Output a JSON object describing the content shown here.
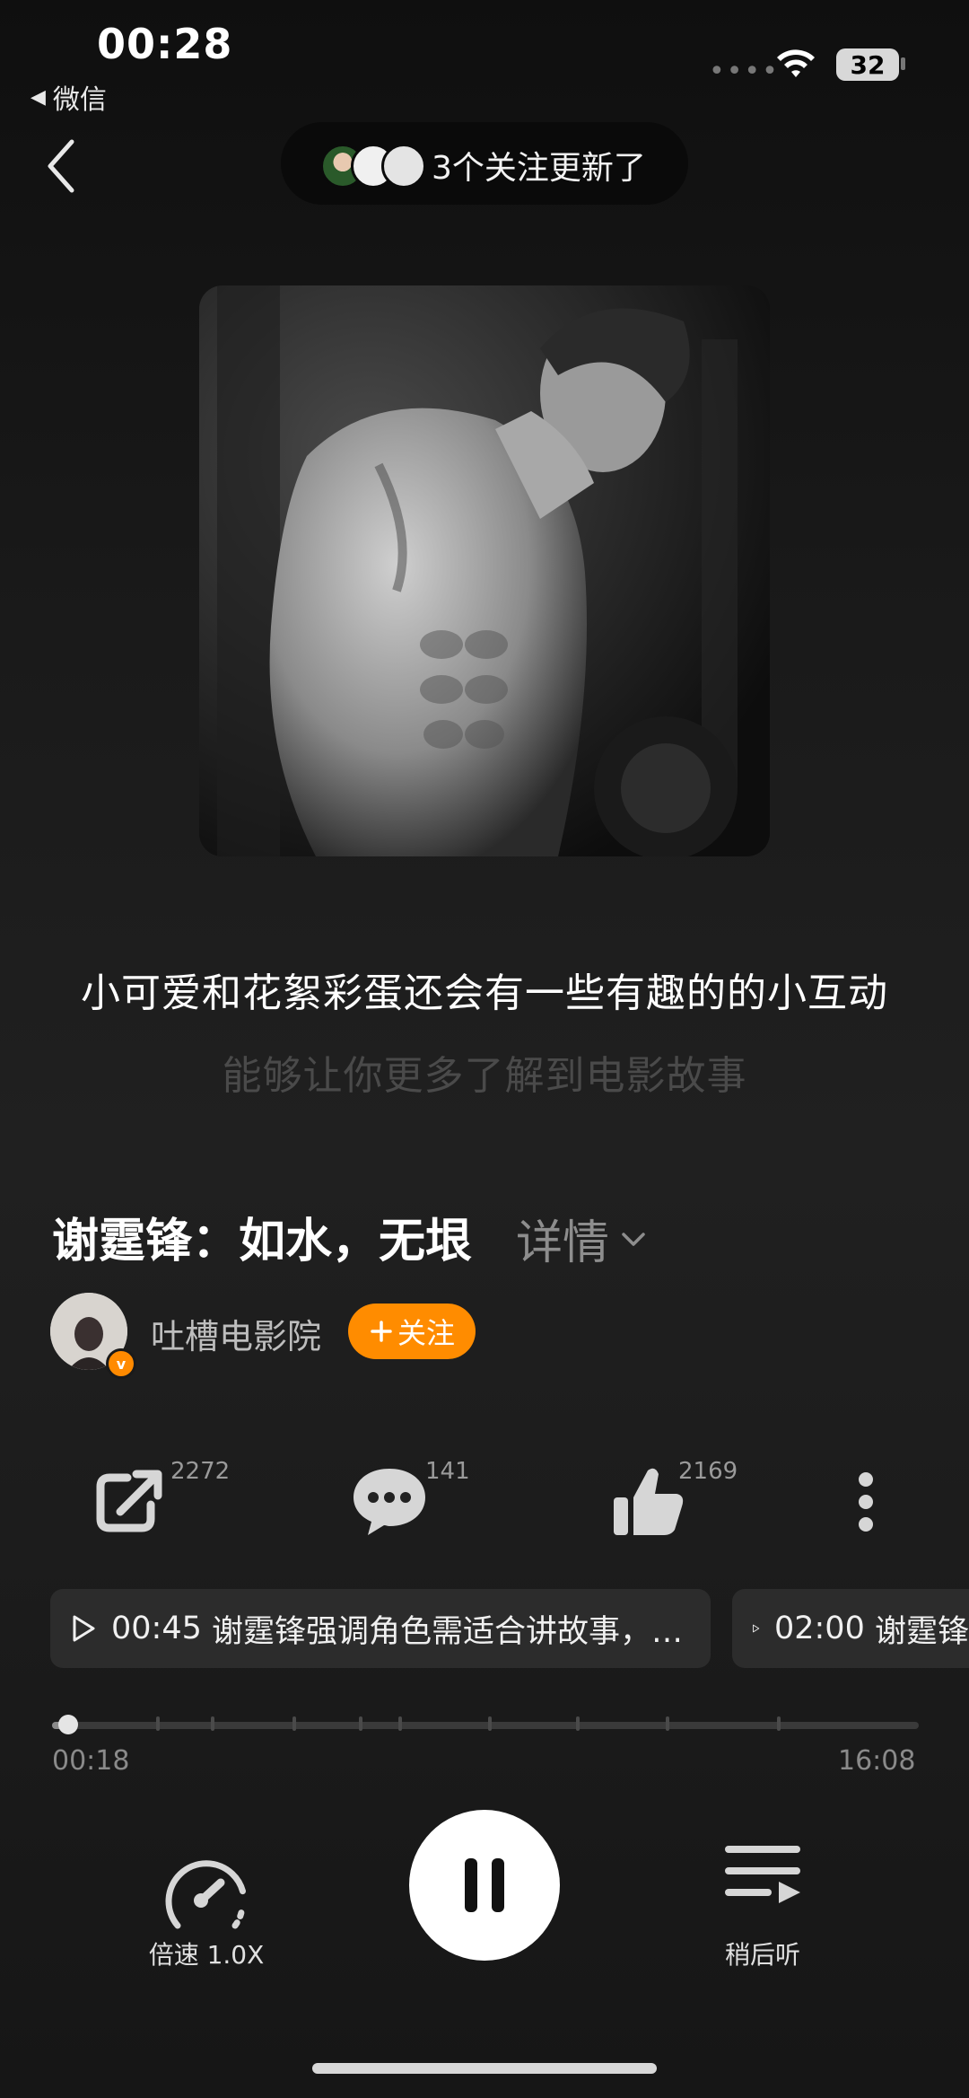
{
  "status_bar": {
    "time": "00:28",
    "back_app": "微信",
    "signal_dots": "••••",
    "battery": "32"
  },
  "header": {
    "follow_update_text": "3个关注更新了"
  },
  "lyrics": {
    "current": "小可爱和花絮彩蛋还会有一些有趣的的小互动",
    "next": "能够让你更多了解到电影故事"
  },
  "episode": {
    "title": "谢霆锋：如水，无垠",
    "detail_label": "详情"
  },
  "author": {
    "name": "吐槽电影院",
    "badge": "v",
    "follow_label": "关注"
  },
  "actions": {
    "share_count": "2272",
    "comment_count": "141",
    "like_count": "2169"
  },
  "chapters": [
    {
      "time": "00:45",
      "text": "谢霆锋强调角色需适合讲故事，…"
    },
    {
      "time": "02:00",
      "text": "谢霆锋"
    }
  ],
  "player": {
    "current_time": "00:18",
    "total_time": "16:08",
    "progress_fraction": 0.019,
    "speed_label": "倍速 1.0X",
    "later_label": "稍后听"
  },
  "colors": {
    "accent": "#ff8c00",
    "background": "#1a1a1a"
  }
}
